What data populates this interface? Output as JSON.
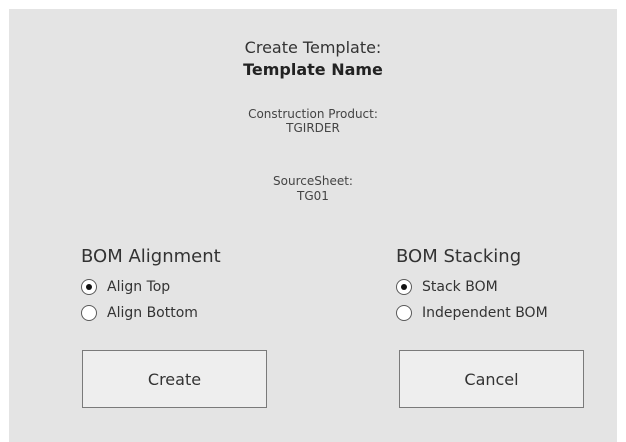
{
  "dialog": {
    "title": "Create Template:",
    "template_name": "Template Name",
    "construction_product_label": "Construction Product:",
    "construction_product_value": "TGIRDER",
    "source_sheet_label": "SourceSheet:",
    "source_sheet_value": "TG01"
  },
  "bom_alignment": {
    "heading": "BOM Alignment",
    "options": [
      {
        "label": "Align Top",
        "checked": true
      },
      {
        "label": "Align Bottom",
        "checked": false
      }
    ]
  },
  "bom_stacking": {
    "heading": "BOM Stacking",
    "options": [
      {
        "label": "Stack BOM",
        "checked": true
      },
      {
        "label": "Independent BOM",
        "checked": false
      }
    ]
  },
  "buttons": {
    "create_label": "Create",
    "cancel_label": "Cancel"
  },
  "colors": {
    "dialog_background": "#e4e4e4",
    "button_background": "#eeeeee",
    "button_border": "#7a7a7a"
  }
}
